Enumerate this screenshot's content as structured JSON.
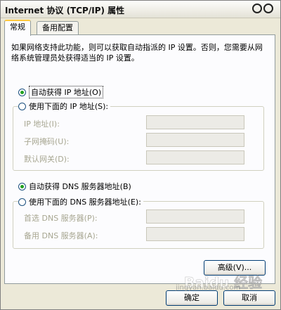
{
  "window": {
    "title": "Internet 协议 (TCP/IP) 属性"
  },
  "tabs": [
    {
      "label": "常规"
    },
    {
      "label": "备用配置"
    }
  ],
  "general": {
    "intro": "如果网络支持此功能，则可以获取自动指派的 IP 设置。否则，您需要从网络系统管理员处获得适当的 IP 设置。",
    "ip_auto": {
      "label": "自动获得 IP 地址(O)",
      "selected": true
    },
    "ip_manual": {
      "label": "使用下面的 IP 地址(S):",
      "selected": false
    },
    "ip_fields": [
      {
        "label": "IP 地址(I):",
        "value": ""
      },
      {
        "label": "子网掩码(U):",
        "value": ""
      },
      {
        "label": "默认网关(D):",
        "value": ""
      }
    ],
    "dns_auto": {
      "label": "自动获得 DNS 服务器地址(B)",
      "selected": true
    },
    "dns_manual": {
      "label": "使用下面的 DNS 服务器地址(E):",
      "selected": false
    },
    "dns_fields": [
      {
        "label": "首选 DNS 服务器(P):",
        "value": ""
      },
      {
        "label": "备用 DNS 服务器(A):",
        "value": ""
      }
    ],
    "advanced_label": "高级(V)..."
  },
  "buttons": {
    "ok": "确定",
    "cancel": "取消"
  },
  "watermark": {
    "main": "Baidu 经验",
    "sub": "jingyan.baidu.com"
  },
  "icons": {
    "title_controls": "rings-icon",
    "radio_selected": "radio-on-icon",
    "radio": "radio-off-icon"
  }
}
